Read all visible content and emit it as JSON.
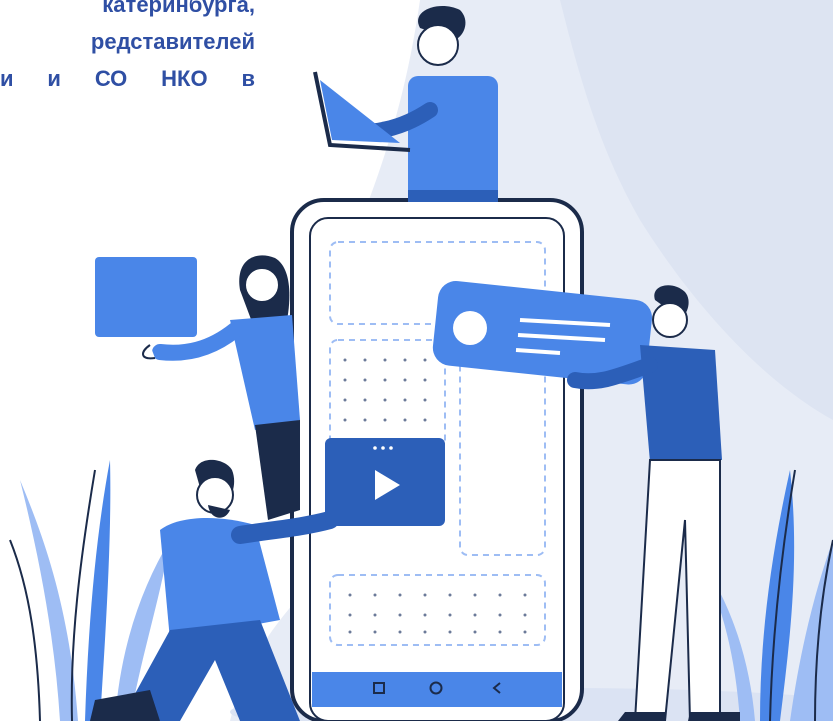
{
  "intro_text": {
    "lines": [
      "катеринбурга,",
      "редставителей",
      "и  и  СО  НКО  в"
    ]
  },
  "phone": {
    "nav_buttons": [
      "square-icon",
      "circle-icon",
      "back-chevron-icon"
    ]
  },
  "colors": {
    "text": "#2f4fa4",
    "accent": "#4a86e8",
    "accent_dark": "#2c5fb8",
    "background_shape": "#e7ecf6",
    "leaf": "#9ebdf4"
  }
}
